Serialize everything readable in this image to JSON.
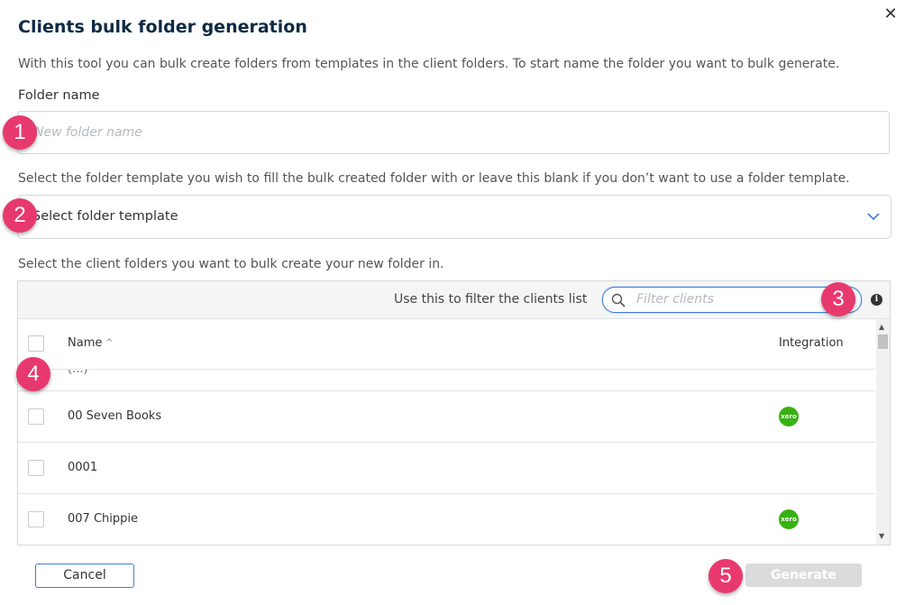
{
  "dialog": {
    "title": "Clients bulk folder generation",
    "close_symbol": "✕",
    "intro": "With this tool you can bulk create folders from templates in the client folders. To start name the folder you want to bulk generate.",
    "folder_name_label": "Folder name",
    "folder_name_placeholder": "New folder name",
    "template_hint": "Select the folder template you wish to fill the bulk created folder with or leave this blank if you don’t want to use a folder template.",
    "template_select_value": "Select folder template",
    "clients_hint": "Select the client folders you want to bulk create your new folder in.",
    "filter_label": "Use this to filter the clients list",
    "filter_placeholder": "Filter clients",
    "info_symbol": "i",
    "columns": {
      "name": "Name",
      "sort_symbol": "^",
      "integration": "Integration"
    },
    "partial_row_text": "(...)",
    "rows": [
      {
        "name": "00 Seven Books",
        "integration": "xero"
      },
      {
        "name": "0001",
        "integration": ""
      },
      {
        "name": "007 Chippie",
        "integration": "xero"
      }
    ],
    "xero_label": "xero",
    "cancel_label": "Cancel",
    "generate_label": "Generate"
  },
  "annotations": [
    "1",
    "2",
    "3",
    "4",
    "5"
  ],
  "colors": {
    "accent": "#3f7dd4",
    "badge": "#e8396e",
    "xero": "#39b113",
    "title": "#0f2a44"
  }
}
